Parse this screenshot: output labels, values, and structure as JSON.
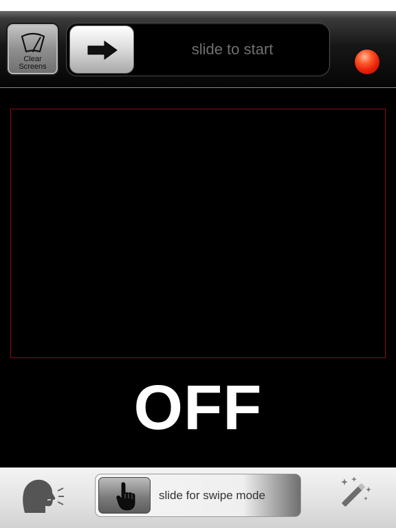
{
  "header": {
    "clear_button": {
      "label": "Clear\nScreens",
      "icon": "windshield-wiper-icon"
    },
    "start_slider": {
      "label": "slide to start",
      "knob_icon": "arrow-right-icon"
    },
    "record_indicator": {
      "icon": "record-dot-icon",
      "color": "#e8200c"
    }
  },
  "main": {
    "status": "OFF",
    "preview_border_color": "#8d0a1a"
  },
  "footer": {
    "speak_button": {
      "icon": "speaking-head-icon"
    },
    "swipe_slider": {
      "label": "slide for swipe mode",
      "knob_icon": "pointing-hand-icon"
    },
    "magic_button": {
      "icon": "magic-wand-icon"
    }
  }
}
